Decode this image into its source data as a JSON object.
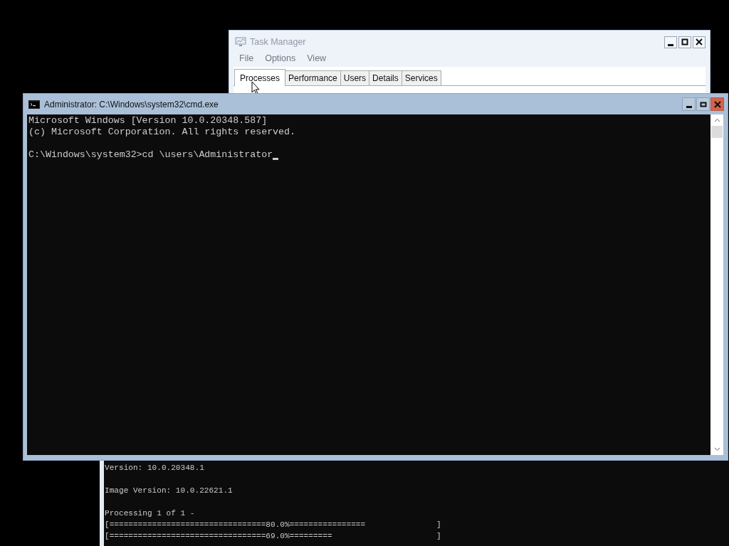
{
  "background_console": {
    "blocks": [
      [
        "Version: 10.0.20348.1"
      ],
      [
        "Image Version: 10.0.22621.1"
      ],
      [
        "Processing 1 of 1 -",
        "[=================================80.0%================               ]",
        "[=================================69.0%=========                      ]"
      ]
    ]
  },
  "task_manager": {
    "title": "Task Manager",
    "menu": [
      "File",
      "Options",
      "View"
    ],
    "tabs": [
      {
        "label": "Processes",
        "selected": true
      },
      {
        "label": "Performance",
        "selected": false
      },
      {
        "label": "Users",
        "selected": false
      },
      {
        "label": "Details",
        "selected": false
      },
      {
        "label": "Services",
        "selected": false
      }
    ]
  },
  "console_window": {
    "title": "Administrator: C:\\Windows\\system32\\cmd.exe",
    "output": [
      "Microsoft Windows [Version 10.0.20348.587]",
      "(c) Microsoft Corporation. All rights reserved."
    ],
    "prompt": "C:\\Windows\\system32>cd \\users\\Administrator"
  }
}
